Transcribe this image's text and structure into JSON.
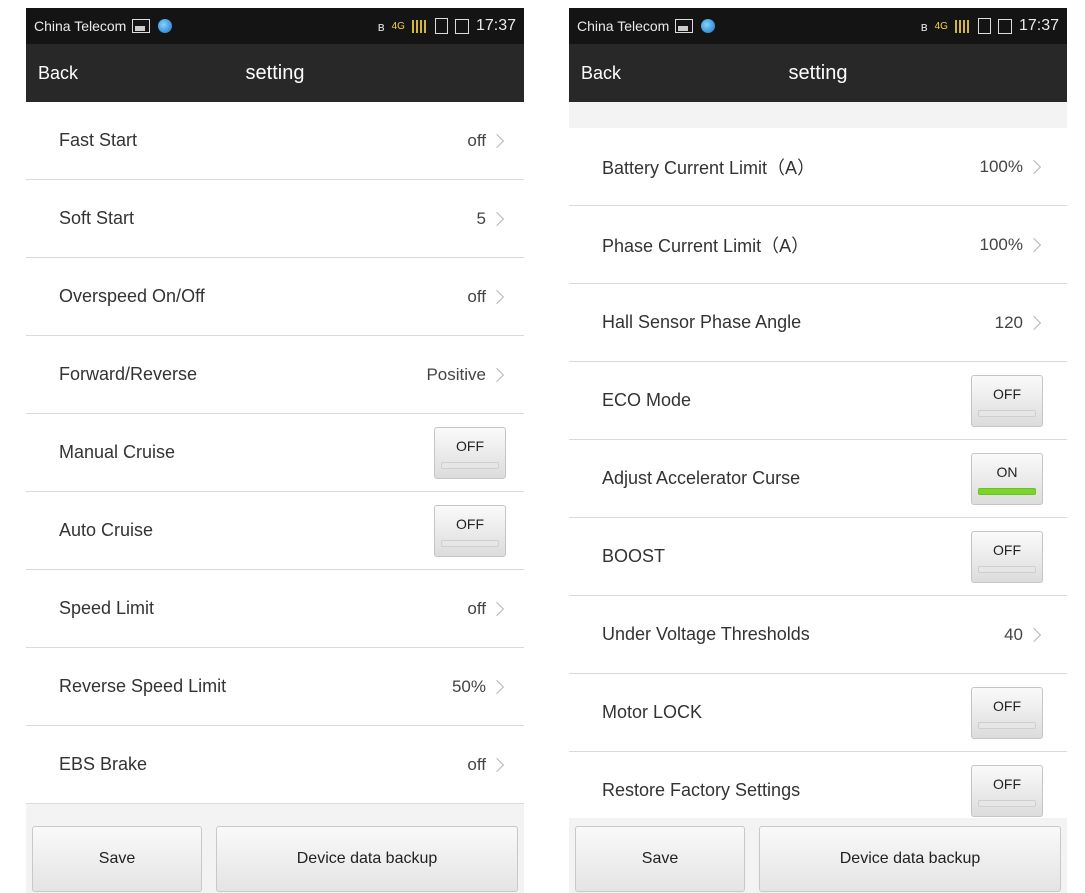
{
  "statusbar": {
    "carrier": "China Telecom",
    "network": "4G",
    "time": "17:37"
  },
  "actionbar": {
    "back_label": "Back",
    "title": "setting"
  },
  "left": {
    "rows": [
      {
        "label": "Fast Start",
        "value": "off",
        "type": "value"
      },
      {
        "label": "Soft Start",
        "value": "5",
        "type": "value"
      },
      {
        "label": "Overspeed On/Off",
        "value": "off",
        "type": "value"
      },
      {
        "label": "Forward/Reverse",
        "value": "Positive",
        "type": "value"
      },
      {
        "label": "Manual Cruise",
        "value": "OFF",
        "type": "toggle"
      },
      {
        "label": "Auto Cruise",
        "value": "OFF",
        "type": "toggle"
      },
      {
        "label": "Speed Limit",
        "value": "off",
        "type": "value"
      },
      {
        "label": "Reverse Speed Limit",
        "value": "50%",
        "type": "value"
      },
      {
        "label": "EBS Brake",
        "value": "off",
        "type": "value"
      }
    ]
  },
  "right": {
    "rows": [
      {
        "label": "Battery Current Limit（A）",
        "value": "100%",
        "type": "value"
      },
      {
        "label": "Phase Current Limit（A）",
        "value": "100%",
        "type": "value"
      },
      {
        "label": "Hall Sensor Phase Angle",
        "value": "120",
        "type": "value"
      },
      {
        "label": "ECO Mode",
        "value": "OFF",
        "type": "toggle"
      },
      {
        "label": "Adjust Accelerator Curse",
        "value": "ON",
        "type": "toggle"
      },
      {
        "label": "BOOST",
        "value": "OFF",
        "type": "toggle"
      },
      {
        "label": "Under Voltage Thresholds",
        "value": "40",
        "type": "value"
      },
      {
        "label": "Motor LOCK",
        "value": "OFF",
        "type": "toggle"
      },
      {
        "label": "Restore Factory Settings",
        "value": "OFF",
        "type": "toggle"
      }
    ]
  },
  "footer": {
    "save_label": "Save",
    "backup_label": "Device data backup"
  },
  "colors": {
    "statusbar_bg": "#141414",
    "actionbar_bg": "#282828",
    "toggle_on": "#7bd62c"
  }
}
